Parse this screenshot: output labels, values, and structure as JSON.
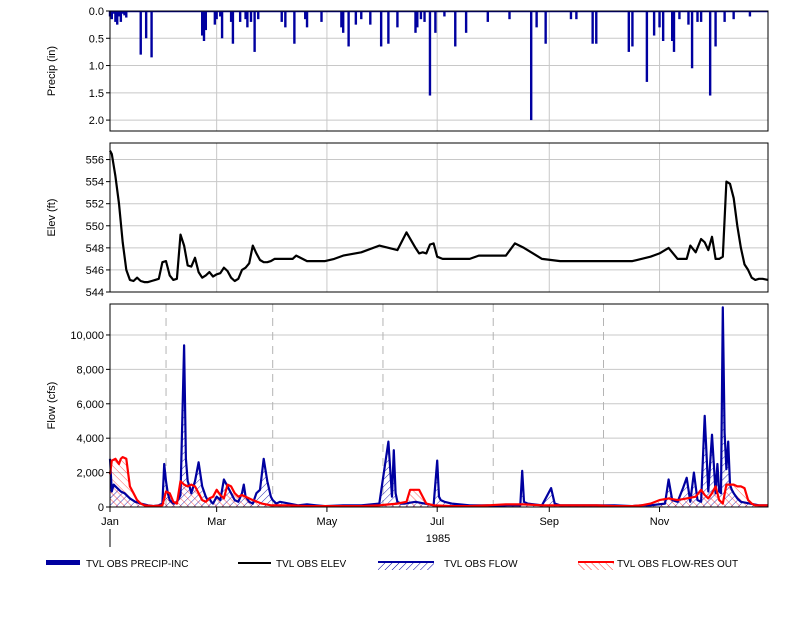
{
  "chart_data": [
    {
      "type": "bar",
      "panel": "precip",
      "ylabel": "Precip (in)",
      "ylim": [
        2.2,
        0.0
      ],
      "y_inverted": true,
      "yticks": [
        "0.0",
        "0.5",
        "1.0",
        "1.5",
        "2.0"
      ],
      "ytick_values": [
        0.0,
        0.5,
        1.0,
        1.5,
        2.0
      ],
      "series": [
        {
          "name": "TVL OBS PRECIP-INC",
          "color": "#0000a0",
          "x_day": [
            1,
            2,
            3,
            4,
            5,
            6,
            7,
            8,
            9,
            10,
            18,
            21,
            24,
            52,
            53,
            54,
            59,
            60,
            62,
            63,
            68,
            69,
            73,
            76,
            77,
            79,
            81,
            83,
            96,
            98,
            103,
            109,
            110,
            118,
            129,
            130,
            133,
            137,
            140,
            145,
            151,
            155,
            160,
            170,
            171,
            173,
            175,
            178,
            181,
            186,
            192,
            198,
            210,
            222,
            234,
            237,
            242,
            256,
            259,
            268,
            270,
            288,
            290,
            298,
            302,
            305,
            307,
            312,
            313,
            316,
            321,
            323,
            326,
            328,
            333,
            336,
            341,
            346,
            355
          ],
          "values": [
            0.1,
            0.15,
            0.05,
            0.2,
            0.25,
            0.1,
            0.2,
            0.05,
            0.08,
            0.12,
            0.8,
            0.5,
            0.85,
            0.45,
            0.55,
            0.35,
            0.25,
            0.15,
            0.1,
            0.5,
            0.2,
            0.6,
            0.2,
            0.15,
            0.3,
            0.2,
            0.75,
            0.15,
            0.2,
            0.3,
            0.6,
            0.15,
            0.3,
            0.2,
            0.3,
            0.4,
            0.65,
            0.25,
            0.15,
            0.25,
            0.65,
            0.6,
            0.3,
            0.4,
            0.3,
            0.15,
            0.2,
            1.55,
            0.4,
            0.1,
            0.65,
            0.4,
            0.2,
            0.15,
            2.0,
            0.3,
            0.6,
            0.15,
            0.15,
            0.6,
            0.6,
            0.75,
            0.65,
            1.3,
            0.45,
            0.3,
            0.55,
            0.55,
            0.75,
            0.15,
            0.25,
            1.05,
            0.2,
            0.2,
            1.55,
            0.65,
            0.2,
            0.15,
            0.1
          ]
        }
      ]
    },
    {
      "type": "line",
      "panel": "elev",
      "ylabel": "Elev (ft)",
      "ylim": [
        544,
        557.5
      ],
      "yticks": [
        "544",
        "546",
        "548",
        "550",
        "552",
        "554",
        "556"
      ],
      "ytick_values": [
        544,
        546,
        548,
        550,
        552,
        554,
        556
      ],
      "series": [
        {
          "name": "TVL OBS ELEV",
          "color": "#000000",
          "x_day": [
            1,
            2,
            4,
            6,
            8,
            10,
            12,
            14,
            16,
            18,
            20,
            22,
            24,
            26,
            28,
            30,
            32,
            34,
            36,
            38,
            40,
            42,
            44,
            46,
            48,
            50,
            52,
            54,
            56,
            58,
            60,
            62,
            64,
            66,
            68,
            70,
            72,
            74,
            76,
            78,
            80,
            82,
            84,
            86,
            88,
            90,
            92,
            94,
            96,
            98,
            100,
            102,
            104,
            110,
            120,
            125,
            130,
            140,
            150,
            160,
            165,
            170,
            172,
            174,
            176,
            178,
            180,
            182,
            185,
            190,
            195,
            196,
            198,
            200,
            205,
            210,
            220,
            225,
            230,
            240,
            245,
            250,
            255,
            260,
            270,
            280,
            290,
            300,
            305,
            310,
            315,
            320,
            322,
            325,
            328,
            330,
            332,
            334,
            336,
            338,
            340,
            342,
            344,
            346,
            348,
            350,
            352,
            354,
            356,
            358,
            360,
            362,
            365
          ],
          "values": [
            556.8,
            556.5,
            554.5,
            552.0,
            548.5,
            546.0,
            545.1,
            545.0,
            545.3,
            545.0,
            544.9,
            544.9,
            545.0,
            545.1,
            545.2,
            546.7,
            546.8,
            545.5,
            545.1,
            545.2,
            549.2,
            548.2,
            546.4,
            546.3,
            547.1,
            545.8,
            545.3,
            545.5,
            545.8,
            545.4,
            545.6,
            545.7,
            546.2,
            545.9,
            545.3,
            545.0,
            545.2,
            546.0,
            546.2,
            546.6,
            548.2,
            547.5,
            546.9,
            546.7,
            546.7,
            546.8,
            547.0,
            547.0,
            547.0,
            547.0,
            547.0,
            547.0,
            547.3,
            546.8,
            546.8,
            547.0,
            547.3,
            547.6,
            548.2,
            547.8,
            549.4,
            548.0,
            547.5,
            547.6,
            547.5,
            548.3,
            548.4,
            547.2,
            547.0,
            547.0,
            547.0,
            547.0,
            547.0,
            547.0,
            547.3,
            547.3,
            547.3,
            548.4,
            548.0,
            547.0,
            546.9,
            546.8,
            546.8,
            546.8,
            546.8,
            546.8,
            546.8,
            547.2,
            547.5,
            548.0,
            547.0,
            547.0,
            548.2,
            547.6,
            548.8,
            548.5,
            547.8,
            549.0,
            547.0,
            547.0,
            547.2,
            554.0,
            553.8,
            552.5,
            550.0,
            548.0,
            546.5,
            546.0,
            545.3,
            545.1,
            545.2,
            545.2,
            545.1
          ]
        }
      ]
    },
    {
      "type": "line",
      "panel": "flow",
      "ylabel": "Flow (cfs)",
      "ylim": [
        0,
        11800
      ],
      "yticks": [
        "0",
        "2,000",
        "4,000",
        "6,000",
        "8,000",
        "10,000"
      ],
      "ytick_values": [
        0,
        2000,
        4000,
        6000,
        8000,
        10000
      ],
      "xticks": [
        "Jan",
        "Mar",
        "May",
        "Jul",
        "Sep",
        "Nov"
      ],
      "xtick_days": [
        1,
        60,
        121,
        182,
        244,
        305
      ],
      "month_boundaries_dashed": [
        32,
        91,
        152,
        213,
        274
      ],
      "xlabel": "1985",
      "series": [
        {
          "name": "TVL OBS FLOW",
          "color": "#0000a0",
          "x_day": [
            1,
            2,
            3,
            5,
            7,
            9,
            12,
            15,
            18,
            22,
            25,
            28,
            30,
            31,
            32,
            33,
            34,
            36,
            38,
            40,
            42,
            43,
            44,
            45,
            46,
            48,
            50,
            52,
            54,
            55,
            56,
            57,
            58,
            60,
            62,
            64,
            68,
            70,
            72,
            74,
            75,
            76,
            78,
            80,
            82,
            84,
            86,
            88,
            90,
            91,
            92,
            93,
            95,
            100,
            105,
            110,
            115,
            120,
            130,
            140,
            150,
            155,
            157,
            158,
            159,
            160,
            162,
            164,
            170,
            175,
            180,
            182,
            183,
            184,
            186,
            190,
            200,
            210,
            215,
            220,
            228,
            229,
            230,
            232,
            240,
            245,
            247,
            250,
            260,
            270,
            280,
            290,
            295,
            300,
            308,
            310,
            312,
            315,
            318,
            320,
            322,
            324,
            326,
            328,
            330,
            332,
            334,
            336,
            337,
            338,
            339,
            340,
            341,
            342,
            343,
            344,
            345,
            346,
            348,
            350,
            355,
            360,
            365
          ],
          "values": [
            2800,
            900,
            1300,
            1100,
            900,
            800,
            500,
            300,
            200,
            100,
            50,
            100,
            200,
            2500,
            1500,
            800,
            400,
            200,
            300,
            700,
            9400,
            2800,
            1500,
            1200,
            800,
            1500,
            2600,
            1200,
            600,
            400,
            500,
            300,
            200,
            600,
            400,
            1600,
            800,
            400,
            300,
            800,
            1300,
            600,
            300,
            200,
            800,
            1000,
            2800,
            1500,
            600,
            400,
            300,
            200,
            300,
            200,
            100,
            150,
            100,
            50,
            100,
            100,
            200,
            3800,
            600,
            3300,
            800,
            300,
            200,
            200,
            300,
            200,
            100,
            2700,
            600,
            400,
            300,
            200,
            100,
            100,
            50,
            100,
            100,
            2100,
            300,
            200,
            100,
            1100,
            200,
            100,
            100,
            100,
            100,
            50,
            100,
            100,
            200,
            1600,
            400,
            300,
            1100,
            1700,
            300,
            2000,
            400,
            300,
            5300,
            900,
            4200,
            800,
            2500,
            900,
            800,
            11600,
            4300,
            2200,
            3800,
            1300,
            1000,
            800,
            500,
            300,
            200,
            100,
            100
          ]
        },
        {
          "name": "TVL OBS FLOW-RES OUT",
          "color": "#ff0000",
          "x_day": [
            1,
            2,
            4,
            6,
            7,
            8,
            10,
            11,
            12,
            14,
            16,
            18,
            20,
            25,
            30,
            32,
            34,
            36,
            38,
            40,
            42,
            44,
            46,
            48,
            50,
            52,
            54,
            56,
            58,
            60,
            62,
            64,
            66,
            68,
            70,
            72,
            74,
            76,
            80,
            85,
            90,
            95,
            100,
            110,
            120,
            130,
            140,
            150,
            160,
            165,
            167,
            170,
            172,
            174,
            176,
            180,
            190,
            200,
            210,
            220,
            230,
            240,
            250,
            260,
            270,
            280,
            290,
            295,
            300,
            305,
            310,
            315,
            320,
            325,
            328,
            330,
            332,
            334,
            336,
            338,
            340,
            342,
            344,
            346,
            348,
            350,
            352,
            354,
            356,
            358,
            360,
            362,
            365
          ],
          "values": [
            1900,
            2700,
            2800,
            2500,
            2800,
            2900,
            2800,
            2000,
            1200,
            800,
            400,
            200,
            100,
            50,
            100,
            900,
            800,
            300,
            200,
            1500,
            1300,
            1200,
            1300,
            1200,
            800,
            400,
            300,
            500,
            600,
            1000,
            700,
            500,
            1300,
            1200,
            800,
            600,
            700,
            600,
            400,
            200,
            100,
            100,
            100,
            50,
            50,
            50,
            50,
            100,
            200,
            300,
            1000,
            1000,
            1000,
            600,
            200,
            100,
            50,
            50,
            100,
            150,
            150,
            100,
            100,
            100,
            100,
            50,
            50,
            100,
            200,
            400,
            500,
            400,
            500,
            600,
            1000,
            700,
            500,
            800,
            1200,
            400,
            200,
            1300,
            1300,
            1300,
            1200,
            1200,
            1100,
            400,
            200,
            100,
            100,
            100,
            100
          ]
        }
      ]
    }
  ],
  "legend": [
    {
      "label": "TVL OBS PRECIP-INC",
      "color": "#0000a0",
      "style": "thick-bar"
    },
    {
      "label": "TVL OBS ELEV",
      "color": "#000000",
      "style": "line"
    },
    {
      "label": "TVL OBS FLOW",
      "color": "#0000a0",
      "style": "hatched-blue"
    },
    {
      "label": "TVL OBS FLOW-RES OUT",
      "color": "#ff0000",
      "style": "hatched-red"
    }
  ]
}
